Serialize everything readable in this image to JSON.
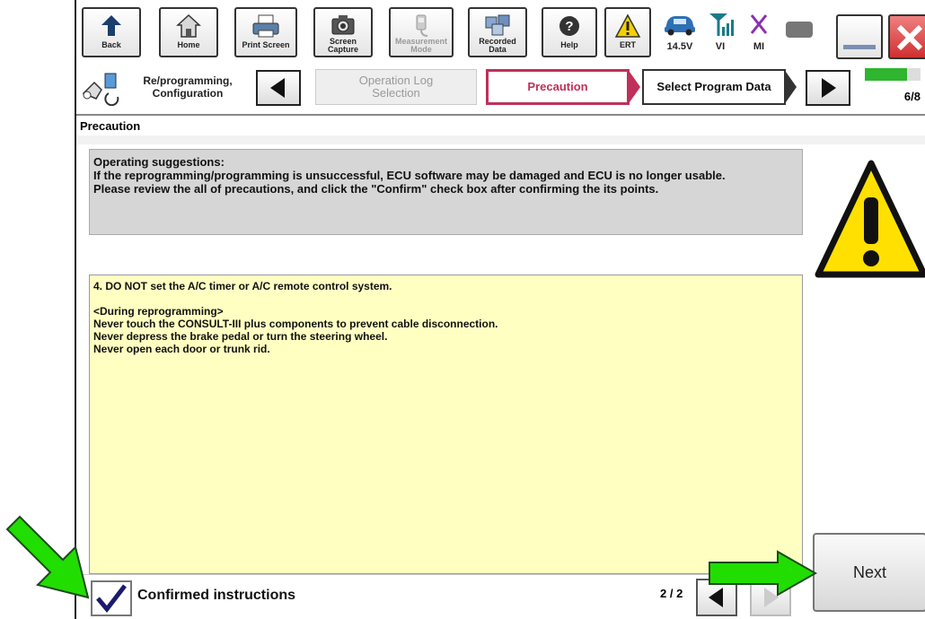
{
  "toolbar": {
    "back": "Back",
    "home": "Home",
    "print_screen": "Print Screen",
    "screen_capture": [
      "Screen",
      "Capture"
    ],
    "measurement_mode": [
      "Measurement",
      "Mode"
    ],
    "recorded_data": [
      "Recorded",
      "Data"
    ],
    "help": "Help",
    "ert": "ERT",
    "battery_voltage": "14.5V",
    "vi": "VI",
    "mi": "MI"
  },
  "steps": {
    "current": "Re/programming,\nConfiguration",
    "previous": "Operation Log\nSelection",
    "active": "Precaution",
    "next": "Select Program Data",
    "progress": "6/8",
    "progress_fraction": 0.75
  },
  "section_title": "Precaution",
  "operating_suggestions": {
    "heading": "Operating  suggestions:",
    "line1": "If the reprogramming/programming is unsuccessful, ECU software may be damaged and ECU is no longer usable.",
    "line2": "Please review the all of precautions, and click the \"Confirm\" check box after confirming the its points."
  },
  "instructions": {
    "item": "4. DO NOT set the A/C timer or A/C remote control system.",
    "subheading": "<During  reprogramming>",
    "lines": [
      "Never touch the CONSULT-III plus components to prevent cable disconnection.",
      "Never depress the brake pedal or turn the steering wheel.",
      "Never open each door or trunk rid."
    ]
  },
  "confirm": {
    "label": "Confirmed instructions",
    "checked": true
  },
  "pagination": "2 / 2",
  "next_button": "Next",
  "colors": {
    "active_step_border": "#c0305a",
    "active_step_text": "#c0305a",
    "suggestion_bg": "#d6d6d6",
    "instruction_bg": "#ffffc2",
    "progress_fill": "#2fb52f",
    "arrow_green": "#22dd00",
    "close_red": "#e04040",
    "warning_yellow": "#ffe000"
  }
}
